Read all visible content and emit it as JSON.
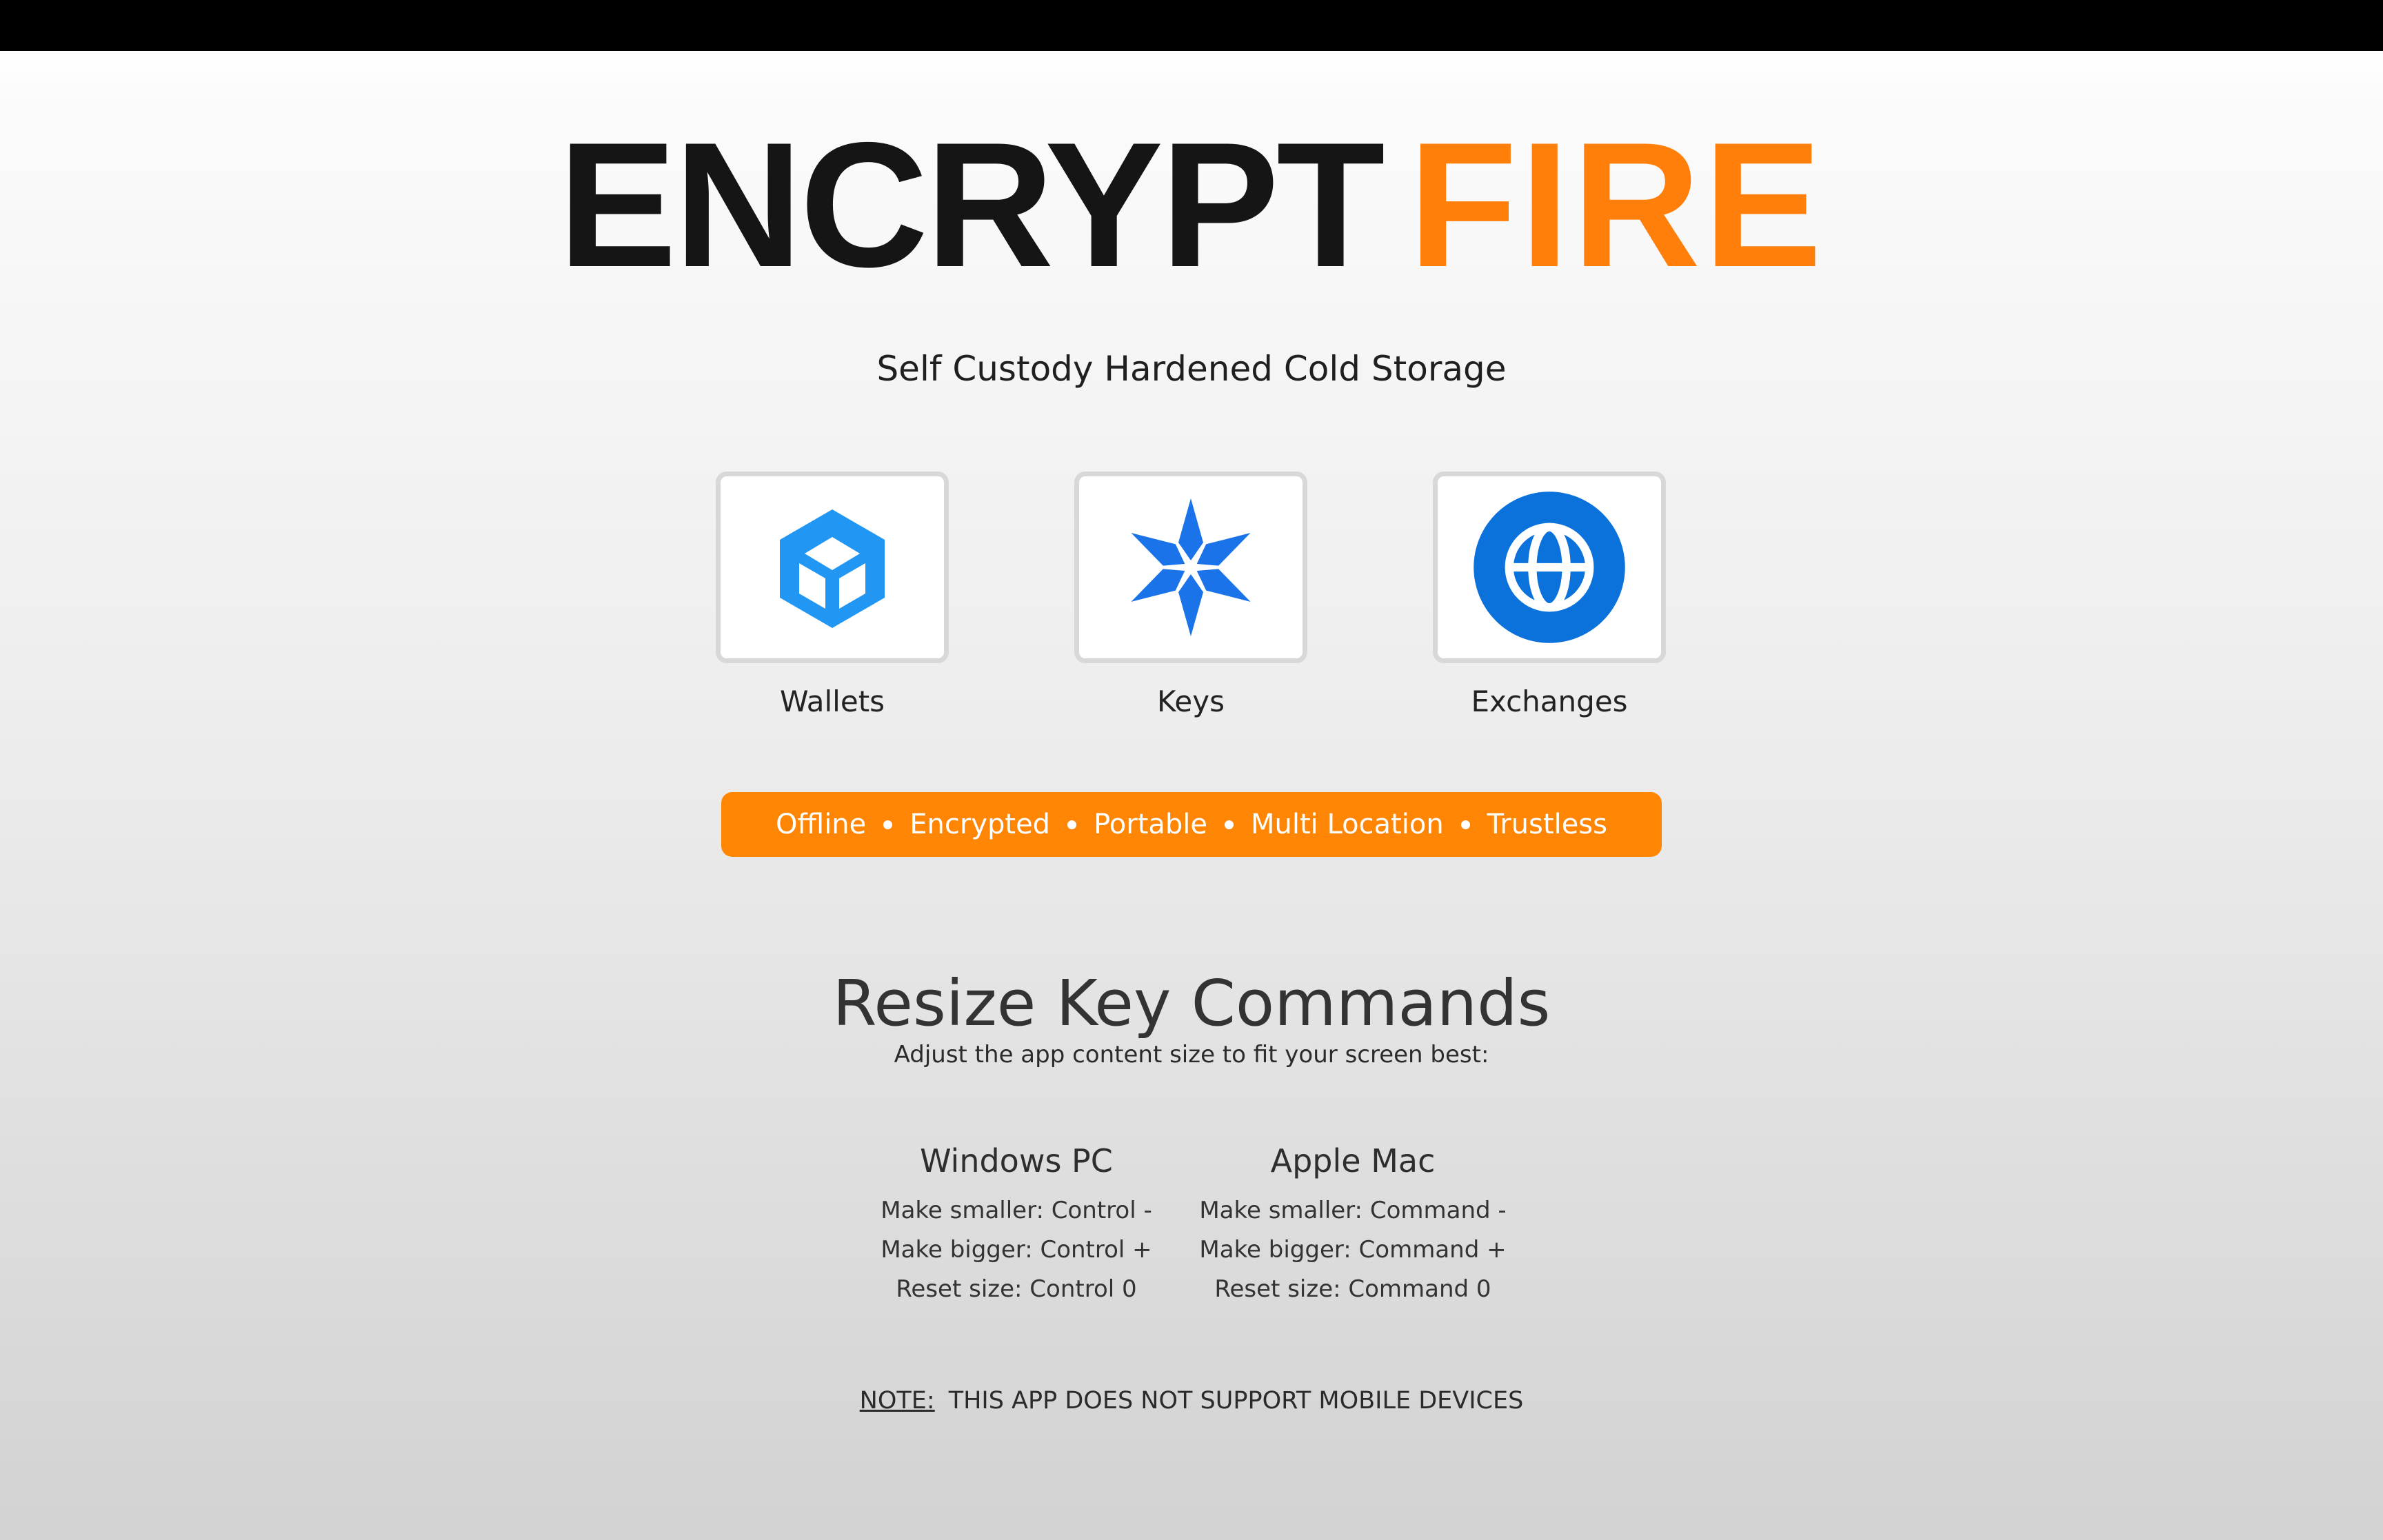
{
  "logo": {
    "part_dark": "ENCRYPT",
    "part_accent": "FIRE",
    "accent_color": "#ff7f0a"
  },
  "tagline": "Self Custody Hardened Cold Storage",
  "tiles": [
    {
      "label": "Wallets",
      "icon": "cube-icon",
      "color": "#2196f3"
    },
    {
      "label": "Keys",
      "icon": "snowflake-icon",
      "color": "#1a73e8"
    },
    {
      "label": "Exchanges",
      "icon": "globe-icon",
      "color": "#0b72dc"
    }
  ],
  "features": [
    "Offline",
    "Encrypted",
    "Portable",
    "Multi Location",
    "Trustless"
  ],
  "banner_color": "#ff8505",
  "resize": {
    "title": "Resize Key Commands",
    "subtitle": "Adjust the app content size to fit your screen best:",
    "windows": {
      "heading": "Windows PC",
      "lines": [
        "Make smaller: Control -",
        "Make bigger: Control +",
        "Reset size: Control 0"
      ]
    },
    "mac": {
      "heading": "Apple Mac",
      "lines": [
        "Make smaller: Command -",
        "Make bigger: Command +",
        "Reset size: Command 0"
      ]
    }
  },
  "note": {
    "label": "NOTE:",
    "text": "THIS APP DOES NOT SUPPORT MOBILE DEVICES"
  }
}
